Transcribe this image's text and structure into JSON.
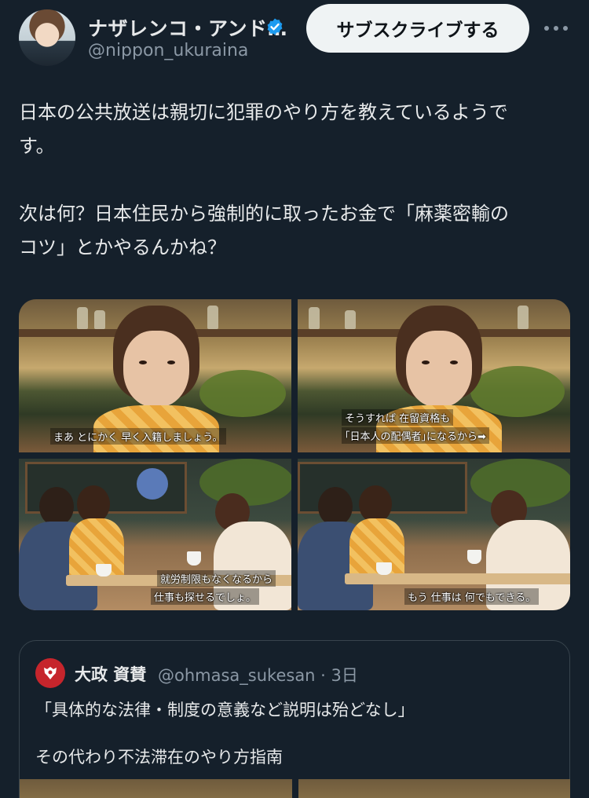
{
  "author": {
    "display_name": "ナザレンコ・アンド…",
    "handle": "@nippon_ukuraina",
    "verified_icon": "verified-badge-icon"
  },
  "actions": {
    "subscribe_label": "サブスクライブする",
    "more_icon": "more-options-icon"
  },
  "tweet": {
    "text": "日本の公共放送は親切に犯罪のやり方を教えているようで\nす。\n\n次は何？日本住民から強制的に取ったお金で「麻薬密輸の\nコツ」とかやるんかね？"
  },
  "media": [
    {
      "subtitle_lines": [
        "まあ とにかく 早く入籍しましょう。"
      ]
    },
    {
      "subtitle_lines": [
        "そうすれば 在留資格も",
        "｢日本人の配偶者｣になるから➡"
      ]
    },
    {
      "subtitle_lines": [
        "就労制限もなくなるから",
        "仕事も探せるでしょ。"
      ]
    },
    {
      "subtitle_lines": [
        "もう 仕事は 何でもできる。"
      ]
    }
  ],
  "quoted_tweet": {
    "display_name": "大政 資賛",
    "meta": "@ohmasa_sukesan · 3日",
    "line1": "「具体的な法律・制度の意義など説明は殆どなし」",
    "line2": "その代わり不法滞在のやり方指南"
  },
  "colors": {
    "background": "#15202b",
    "text": "#e7e9ea",
    "secondary": "#8b98a5",
    "verified": "#1d9bf0",
    "button_bg": "#eff3f4"
  }
}
